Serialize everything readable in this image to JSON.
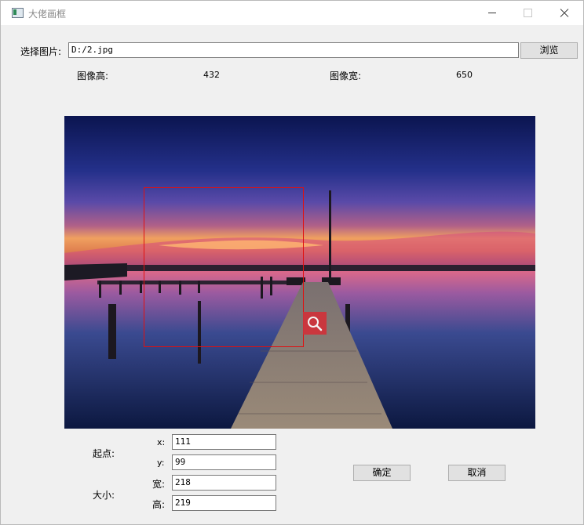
{
  "window": {
    "title": "大佬画框"
  },
  "file": {
    "label": "选择图片:",
    "path": "D:/2.jpg",
    "browse_label": "浏览"
  },
  "image_info": {
    "height_label": "图像高:",
    "height_value": "432",
    "width_label": "图像宽:",
    "width_value": "650"
  },
  "selection": {
    "start_label": "起点:",
    "x_label": "x:",
    "x_value": "111",
    "y_label": "y:",
    "y_value": "99",
    "size_label": "大小:",
    "w_label": "宽:",
    "w_value": "218",
    "h_label": "高:",
    "h_value": "219"
  },
  "buttons": {
    "ok_label": "确定",
    "cancel_label": "取消"
  },
  "icons": {
    "app": "app-window-icon",
    "zoom": "magnifier-icon"
  },
  "colors": {
    "selection_border": "#e01010",
    "zoom_badge": "#d0323a",
    "window_bg": "#f0f0f0"
  }
}
